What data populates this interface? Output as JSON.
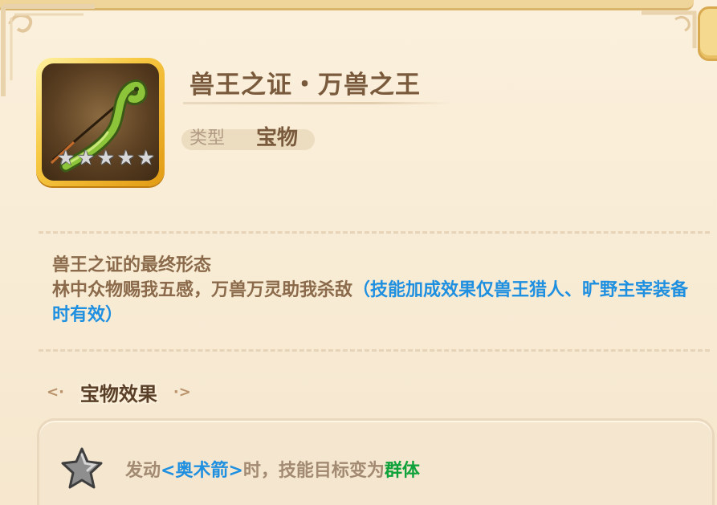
{
  "item": {
    "name": "兽王之证・万兽之王",
    "type_label": "类型",
    "type_value": "宝物",
    "stars": 5,
    "icon": "green-bow-icon"
  },
  "description": {
    "line1": "兽王之证的最终形态",
    "line2": "林中众物赐我五感，万兽万灵助我杀敌",
    "note": "（技能加成效果仅兽王猎人、旷野主宰装备时有效）"
  },
  "section": {
    "title": "宝物效果"
  },
  "effect": {
    "prefix": "发动",
    "skill": "<奥术箭>",
    "middle": "时，技能目标变为",
    "target": "群体",
    "icon": "gray-star-icon"
  },
  "colors": {
    "title": "#7a5a3c",
    "highlight_blue": "#1f8fe0",
    "highlight_green": "#10a23a",
    "frame_gold": "#f7c842"
  }
}
